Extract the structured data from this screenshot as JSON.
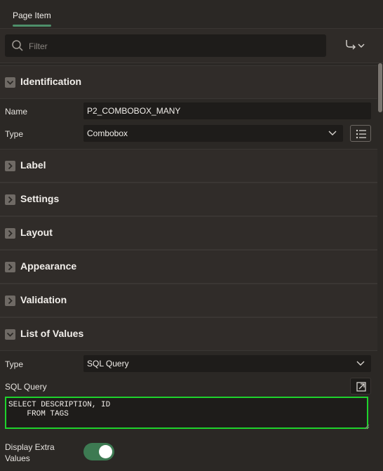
{
  "tabs": [
    {
      "label": "Page Item"
    }
  ],
  "toolbar": {
    "filter_placeholder": "Filter"
  },
  "sections": {
    "identification": "Identification",
    "label": "Label",
    "settings": "Settings",
    "layout": "Layout",
    "appearance": "Appearance",
    "validation": "Validation",
    "list_of_values": "List of Values"
  },
  "identification": {
    "name_label": "Name",
    "name_value": "P2_COMBOBOX_MANY",
    "type_label": "Type",
    "type_value": "Combobox"
  },
  "lov": {
    "type_label": "Type",
    "type_value": "SQL Query",
    "sql_label": "SQL Query",
    "sql_value": "SELECT DESCRIPTION, ID\n    FROM TAGS",
    "display_extra_label": "Display Extra Values",
    "display_extra_on": true
  },
  "colors": {
    "accent": "#4e8f6a",
    "highlight": "#1ed32c",
    "toggle_on": "#3d7a52"
  }
}
